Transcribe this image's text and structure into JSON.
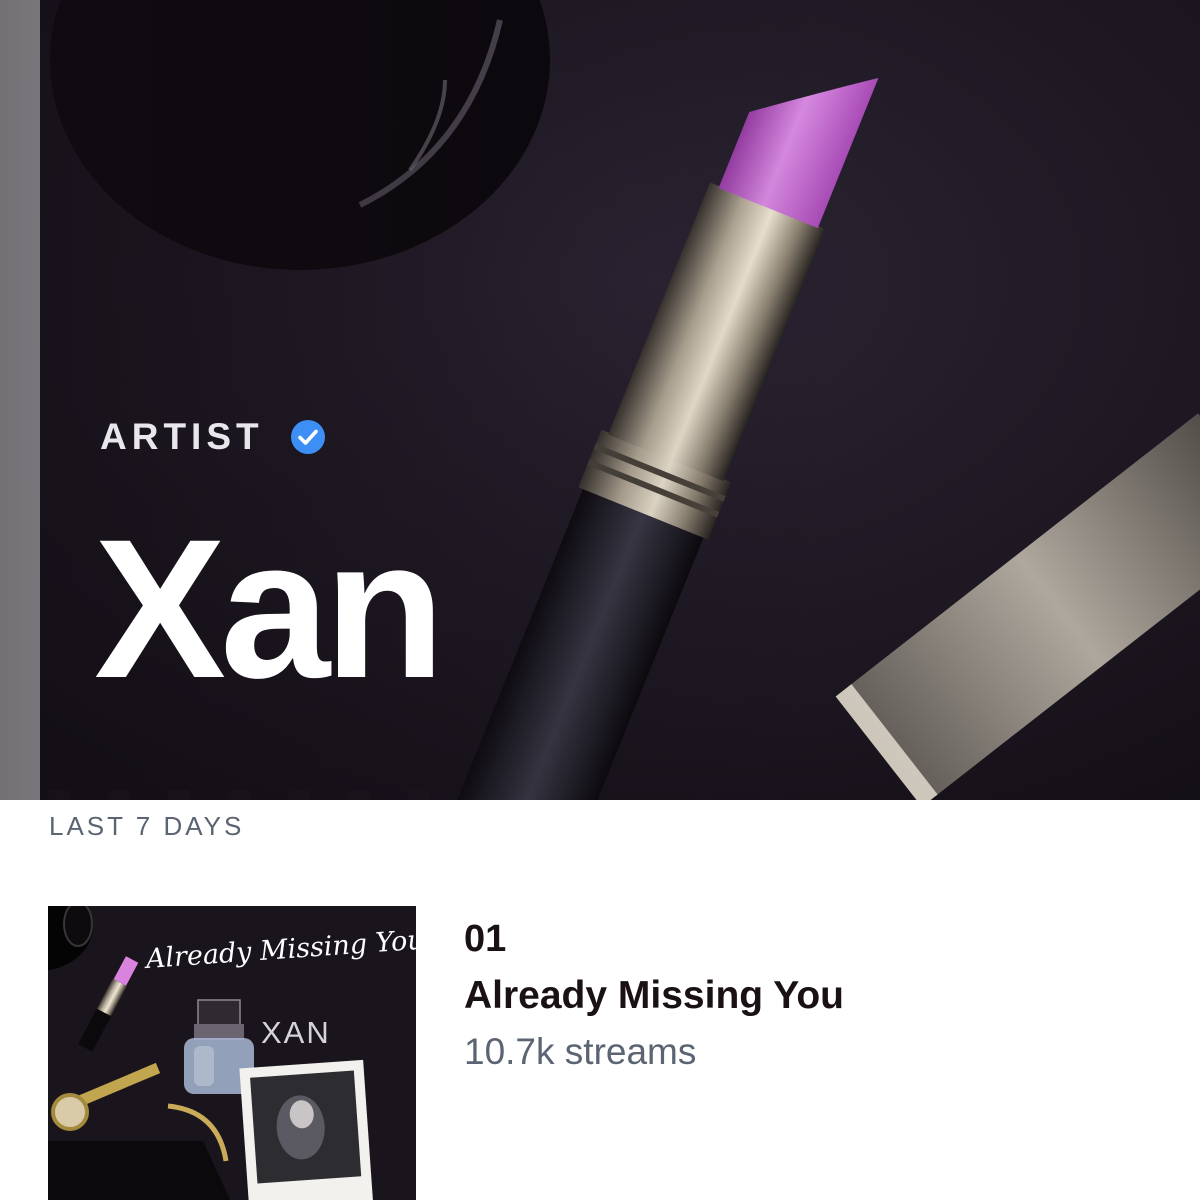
{
  "hero": {
    "label": "ARTIST",
    "verified_icon": "verified-check-icon",
    "name": "Xan"
  },
  "top_songs": {
    "period": "LAST 7 DAYS",
    "tracks": [
      {
        "rank": "01",
        "title": "Already Missing You",
        "streams": "10.7k streams",
        "cover_title": "Already Missing You",
        "cover_artist": "XAN"
      }
    ]
  },
  "colors": {
    "hero_background": "#1c1620",
    "lipstick": "#c75bd6",
    "verified_badge": "#3d8ff5",
    "text_primary": "#1a1114",
    "text_secondary": "#5b6473"
  }
}
